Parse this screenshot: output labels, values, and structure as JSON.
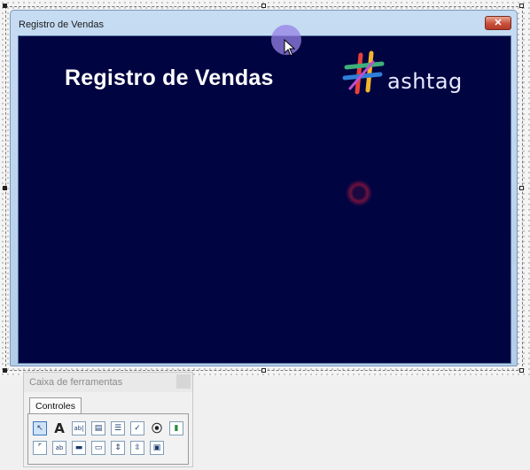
{
  "userform": {
    "title": "Registro de Vendas",
    "close_glyph": "✕",
    "background_color": "#000441",
    "heading": "Registro de Vendas",
    "logo_text": "ashtag",
    "logo_icon": "hashtag-logo-icon"
  },
  "toolbox": {
    "title": "Caixa de ferramentas",
    "tab_label": "Controles",
    "tools": [
      {
        "icon": "select-objects-icon",
        "glyph": "↖"
      },
      {
        "icon": "label-icon",
        "glyph": "A"
      },
      {
        "icon": "textbox-icon",
        "glyph": "ab|"
      },
      {
        "icon": "combobox-icon",
        "glyph": "▤"
      },
      {
        "icon": "listbox-icon",
        "glyph": "☰"
      },
      {
        "icon": "checkbox-icon",
        "glyph": "✓"
      },
      {
        "icon": "optionbutton-icon",
        "glyph": "⦿"
      },
      {
        "icon": "togglebutton-icon",
        "glyph": "▮"
      },
      {
        "icon": "frame-icon",
        "glyph": "⌜"
      },
      {
        "icon": "commandbutton-icon",
        "glyph": "ab"
      },
      {
        "icon": "tabstrip-icon",
        "glyph": "▬"
      },
      {
        "icon": "multipage-icon",
        "glyph": "▭"
      },
      {
        "icon": "scrollbar-icon",
        "glyph": "⇕"
      },
      {
        "icon": "spinbutton-icon",
        "glyph": "⇳"
      },
      {
        "icon": "image-icon",
        "glyph": "▣"
      }
    ]
  }
}
